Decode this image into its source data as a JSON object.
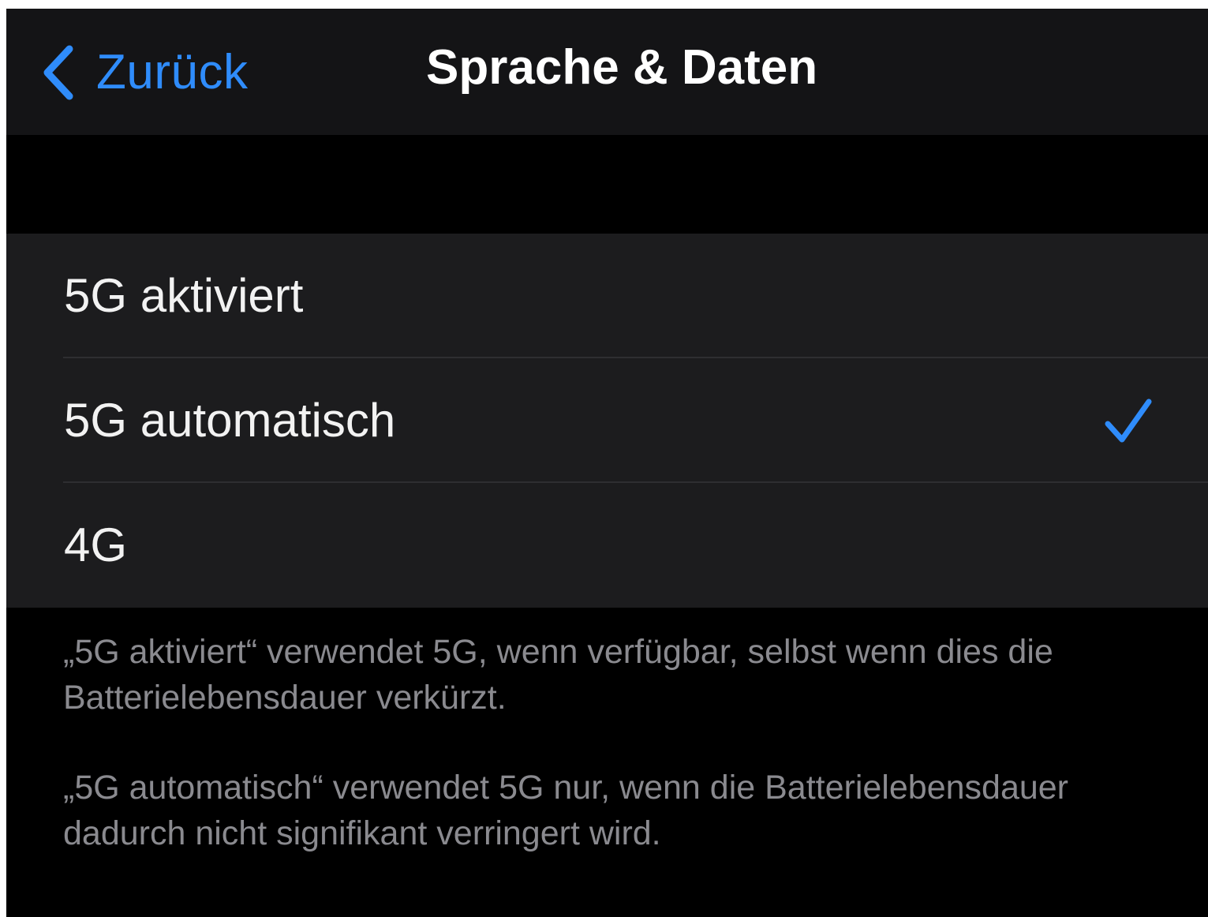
{
  "navbar": {
    "back_label": "Zurück",
    "title": "Sprache & Daten"
  },
  "options": [
    {
      "label": "5G aktiviert",
      "selected": false
    },
    {
      "label": "5G automatisch",
      "selected": true
    },
    {
      "label": "4G",
      "selected": false
    }
  ],
  "footer": {
    "paragraph1": "„5G aktiviert“ verwendet 5G, wenn verfügbar, selbst wenn dies die Batterielebensdauer verkürzt.",
    "paragraph2": "„5G automatisch“ verwendet 5G nur, wenn die Batterielebensdauer dadurch nicht signifikant verringert wird."
  },
  "icons": {
    "back": "chevron-left-icon",
    "selected": "checkmark-icon"
  },
  "colors": {
    "accent": "#2f8cfb",
    "background": "#000000",
    "navbar": "#141416",
    "cell": "#1c1c1e",
    "footer_text": "#8a8a8f"
  }
}
